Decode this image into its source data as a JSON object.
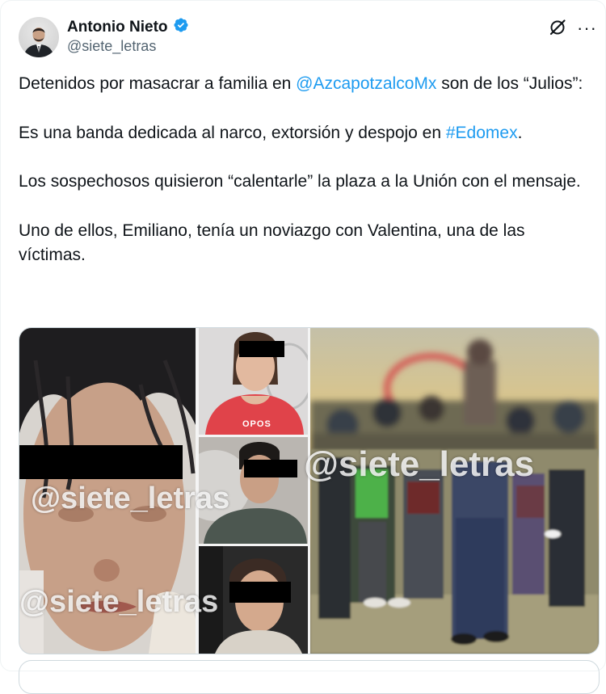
{
  "post": {
    "author_name": "Antonio Nieto",
    "author_handle": "@siete_letras",
    "paragraphs": [
      {
        "segments": [
          {
            "text": "Detenidos por masacrar a familia en ",
            "link": false
          },
          {
            "text": "@AzcapotzalcoMx",
            "link": true
          },
          {
            "text": " son de los “Julios”:",
            "link": false
          }
        ]
      },
      {
        "segments": [
          {
            "text": "Es una banda dedicada al narco, extorsión y despojo en ",
            "link": false
          },
          {
            "text": "#Edomex",
            "link": true
          },
          {
            "text": ".",
            "link": false
          }
        ]
      },
      {
        "segments": [
          {
            "text": "Los sospechosos quisieron “calentarle” la plaza a la Unión con el mensaje.",
            "link": false
          }
        ]
      },
      {
        "segments": [
          {
            "text": "Uno de ellos, Emiliano, tenía un noviazgo con Valentina, una de las víctimas.",
            "link": false
          }
        ]
      }
    ]
  },
  "media": {
    "watermark_left_1": "@siete_letras",
    "watermark_left_2": "@siete_letras",
    "watermark_right": "@siete_letras",
    "shirt_text": "OPOS"
  },
  "colors": {
    "link": "#1d9bf0",
    "verified": "#1d9bf0",
    "text": "#0f1419",
    "secondary": "#536471"
  },
  "icons": {
    "verified": "verified-badge-icon",
    "grok": "grok-icon",
    "more": "more-icon"
  }
}
